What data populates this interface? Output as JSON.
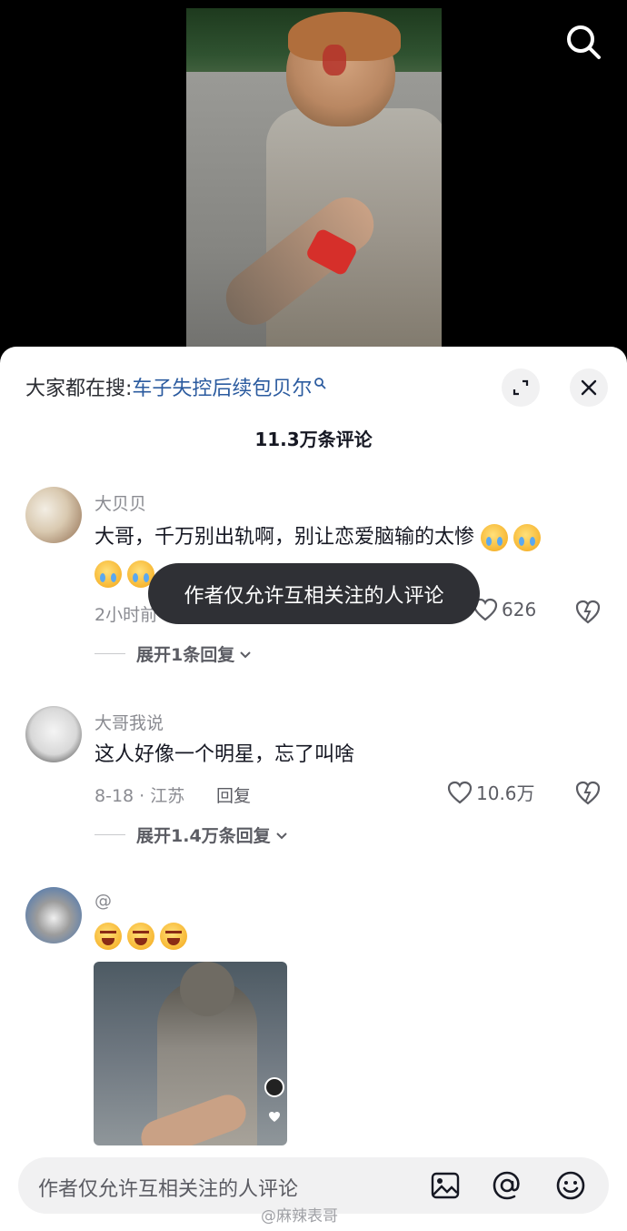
{
  "header": {
    "search_icon": "search-icon"
  },
  "sheet": {
    "hot_search_prefix": "大家都在搜:",
    "hot_search_term": "车子失控后续包贝尔",
    "expand_icon": "expand-icon",
    "close_icon": "close-icon",
    "comment_count": "11.3万条评论"
  },
  "comments": [
    {
      "username": "大贝贝",
      "text": "大哥，千万别出轨啊，别让恋爱脑输的太惨",
      "meta_visible": "2小时前",
      "likes": "626",
      "expand": "展开1条回复"
    },
    {
      "username": "大哥我说",
      "text": "这人好像一个明星，忘了叫啥",
      "meta": "8-18 · 江苏",
      "reply": "回复",
      "likes": "10.6万",
      "expand": "展开1.4万条回复"
    },
    {
      "username": "@"
    }
  ],
  "toast": "作者仅允许互相关注的人评论",
  "input": {
    "placeholder": "作者仅允许互相关注的人评论",
    "icons": [
      "image-icon",
      "at-icon",
      "emoji-icon"
    ]
  },
  "watermark": "@麻辣表哥",
  "colors": {
    "link": "#2b5b9f",
    "toast_bg": "#2f3035",
    "muted": "#8a8b91"
  }
}
